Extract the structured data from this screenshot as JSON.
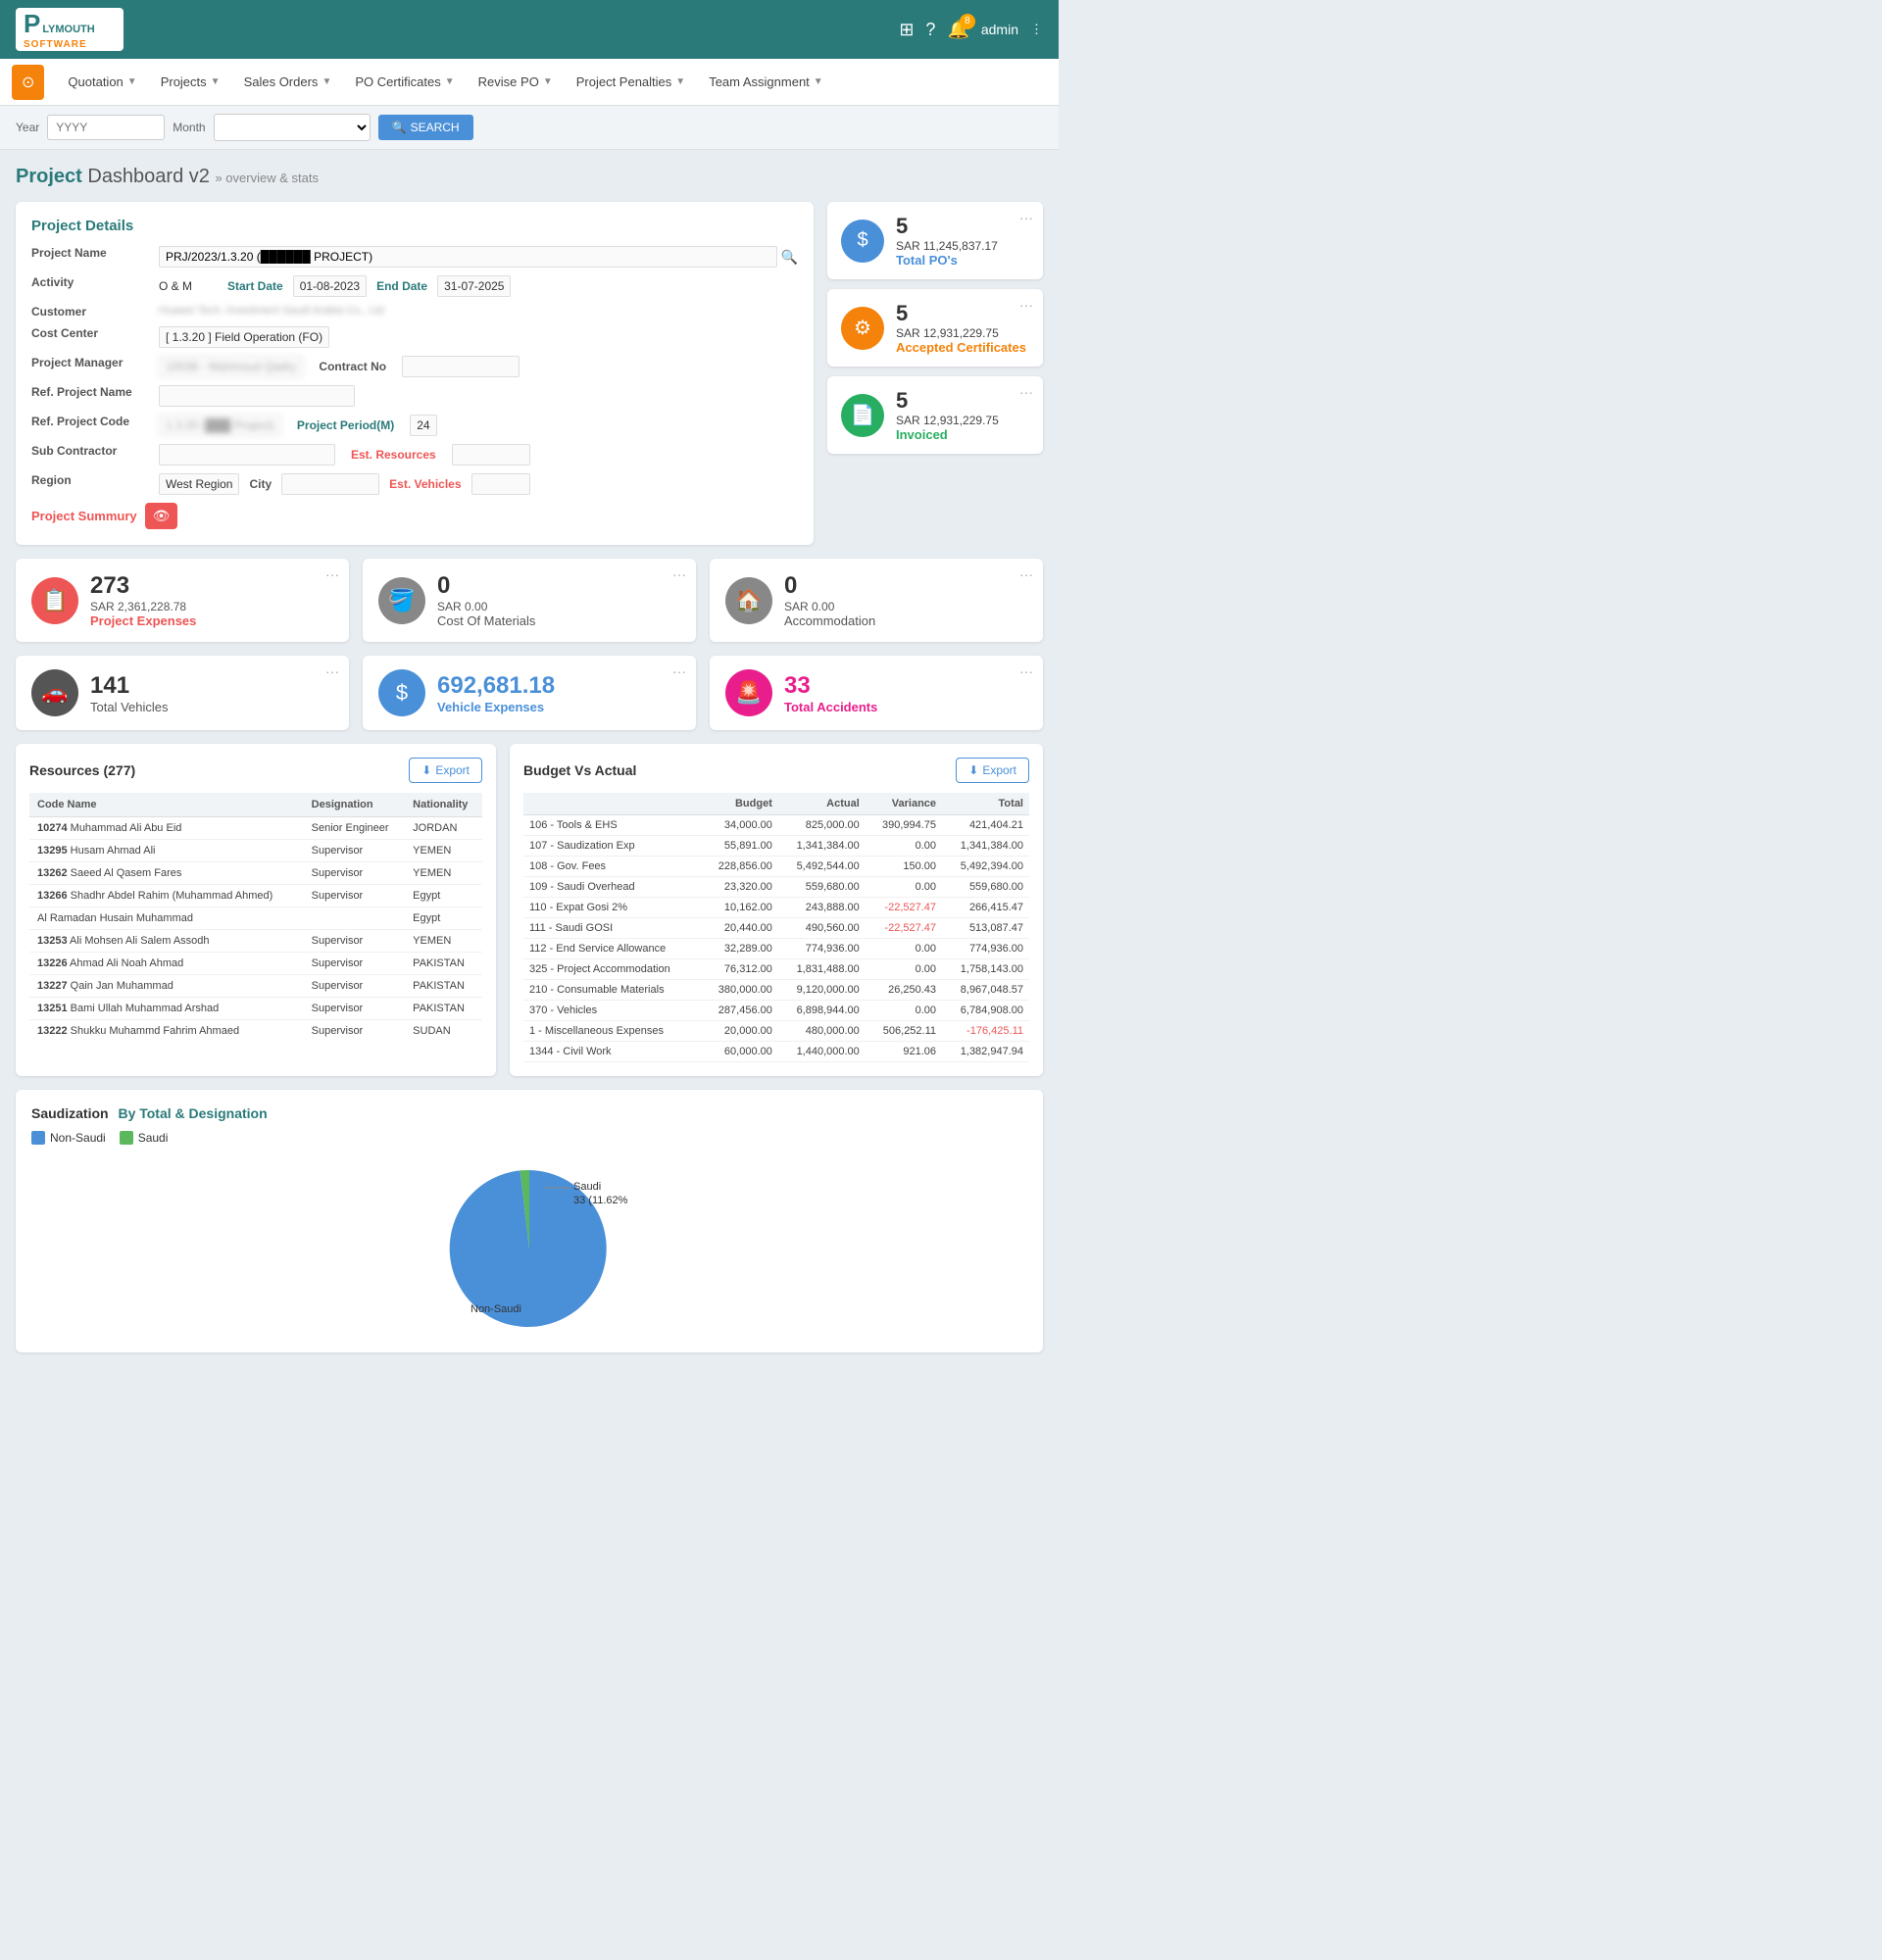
{
  "header": {
    "logo_p": "P",
    "logo_name": "LYMOUTH",
    "logo_software": "SOFTWARE",
    "notif_count": "8",
    "admin_label": "admin"
  },
  "nav": {
    "home_icon": "⊙",
    "items": [
      {
        "label": "Quotation",
        "key": "quotation"
      },
      {
        "label": "Projects",
        "key": "projects"
      },
      {
        "label": "Sales Orders",
        "key": "sales-orders"
      },
      {
        "label": "PO Certificates",
        "key": "po-certificates"
      },
      {
        "label": "Revise PO",
        "key": "revise-po"
      },
      {
        "label": "Project Penalties",
        "key": "project-penalties"
      },
      {
        "label": "Team Assignment",
        "key": "team-assignment"
      }
    ]
  },
  "filter": {
    "year_label": "Year",
    "year_placeholder": "YYYY",
    "month_label": "Month",
    "search_label": "SEARCH"
  },
  "page_title": {
    "bold": "Project",
    "rest": " Dashboard v2",
    "breadcrumb": "» overview & stats"
  },
  "project_details": {
    "title": "Project Details",
    "fields": {
      "project_name_label": "Project Name",
      "project_name_value": "PRJ/2023/1.3.20 (███████ PROJECT)",
      "activity_label": "Activity",
      "activity_value": "O & M",
      "start_date_label": "Start Date",
      "start_date_value": "01-08-2023",
      "end_date_label": "End Date",
      "end_date_value": "31-07-2025",
      "customer_label": "Customer",
      "customer_value": "Huawei Tech. Investment Saudi Arabia Co., Ltd",
      "cost_center_label": "Cost Center",
      "cost_center_value": "[ 1.3.20 ] Field Operation (FO)",
      "project_manager_label": "Project Manager",
      "project_manager_value": "10038 - Mahmoud Qadry",
      "contract_no_label": "Contract No",
      "contract_no_value": "",
      "ref_project_name_label": "Ref. Project Name",
      "ref_project_name_value": "",
      "ref_project_code_label": "Ref. Project Code",
      "ref_project_code_value": "1.3.20 (███████ Project)",
      "project_period_label": "Project Period(M)",
      "project_period_value": "24",
      "sub_contractor_label": "Sub Contractor",
      "sub_contractor_value": "",
      "est_resources_label": "Est. Resources",
      "est_resources_value": "",
      "region_label": "Region",
      "region_value": "West Region",
      "city_label": "City",
      "city_value": "",
      "est_vehicles_label": "Est. Vehicles",
      "est_vehicles_value": ""
    },
    "project_summury_label": "Project Summury"
  },
  "stat_cards": [
    {
      "count": "5",
      "amount": "SAR 11,245,837.17",
      "label": "Total PO's",
      "color": "blue",
      "icon": "$"
    },
    {
      "count": "5",
      "amount": "SAR 12,931,229.75",
      "label": "Accepted Certificates",
      "color": "orange",
      "icon": "⚙"
    },
    {
      "count": "5",
      "amount": "SAR 12,931,229.75",
      "label": "Invoiced",
      "color": "green",
      "icon": "📄"
    }
  ],
  "metric_blocks": [
    {
      "num": "273",
      "amount": "SAR 2,361,228.78",
      "label": "Project Expenses",
      "icon": "📋",
      "color": "red",
      "num_color": "default",
      "label_color": "red"
    },
    {
      "num": "0",
      "amount": "SAR 0.00",
      "label": "Cost Of Materials",
      "icon": "🪣",
      "color": "gray",
      "num_color": "default",
      "label_color": "default"
    },
    {
      "num": "0",
      "amount": "SAR 0.00",
      "label": "Accommodation",
      "icon": "🏠",
      "color": "gray",
      "num_color": "default",
      "label_color": "default"
    },
    {
      "num": "141",
      "amount": "",
      "label": "Total Vehicles",
      "icon": "🚗",
      "color": "dark",
      "num_color": "default",
      "label_color": "default"
    },
    {
      "num": "692,681.18",
      "amount": "",
      "label": "Vehicle Expenses",
      "icon": "$",
      "color": "blue",
      "num_color": "blue",
      "label_color": "blue"
    },
    {
      "num": "33",
      "amount": "",
      "label": "Total Accidents",
      "icon": "🚨",
      "color": "pink",
      "num_color": "pink",
      "label_color": "pink"
    }
  ],
  "resources": {
    "title": "Resources (277)",
    "export_label": "Export",
    "columns": [
      "Code Name",
      "Designation",
      "Nationality"
    ],
    "rows": [
      {
        "code": "10274",
        "name": "Muhammad Ali Abu Eid",
        "designation": "Senior Engineer",
        "nationality": "JORDAN"
      },
      {
        "code": "13295",
        "name": "Husam Ahmad Ali",
        "designation": "Supervisor",
        "nationality": "YEMEN"
      },
      {
        "code": "13262",
        "name": "Saeed Al Qasem Fares",
        "designation": "Supervisor",
        "nationality": "YEMEN"
      },
      {
        "code": "13266",
        "name": "Shadhr Abdel Rahim (Muhammad Ahmed)",
        "designation": "Supervisor",
        "nationality": "Egypt"
      },
      {
        "code": "",
        "name": "Al Ramadan Husain Muhammad",
        "designation": "",
        "nationality": "Egypt"
      },
      {
        "code": "13253",
        "name": "Ali Mohsen Ali Salem Assodh",
        "designation": "Supervisor",
        "nationality": "YEMEN"
      },
      {
        "code": "13226",
        "name": "Ahmad Ali Noah Ahmad",
        "designation": "Supervisor",
        "nationality": "PAKISTAN"
      },
      {
        "code": "13227",
        "name": "Qain Jan Muhammad",
        "designation": "Supervisor",
        "nationality": "PAKISTAN"
      },
      {
        "code": "13251",
        "name": "Bami Ullah Muhammad Arshad",
        "designation": "Supervisor",
        "nationality": "PAKISTAN"
      },
      {
        "code": "13222",
        "name": "Shukku Muhammd Fahrim Ahmaed",
        "designation": "Supervisor",
        "nationality": "SUDAN"
      }
    ]
  },
  "budget": {
    "title": "Budget Vs Actual",
    "export_label": "Export",
    "columns": [
      "",
      "Budget",
      "Actual",
      "Variance",
      "Total"
    ],
    "rows": [
      {
        "label": "106 - Tools & EHS",
        "budget": "34,000.00",
        "actual": "825,000.00",
        "variance": "390,994.75",
        "total": "421,404.21"
      },
      {
        "label": "107 - Saudization Exp",
        "budget": "55,891.00",
        "actual": "1,341,384.00",
        "variance": "0.00",
        "total": "1,341,384.00"
      },
      {
        "label": "108 - Gov. Fees",
        "budget": "228,856.00",
        "actual": "5,492,544.00",
        "variance": "150.00",
        "total": "5,492,394.00"
      },
      {
        "label": "109 - Saudi Overhead",
        "budget": "23,320.00",
        "actual": "559,680.00",
        "variance": "0.00",
        "total": "559,680.00"
      },
      {
        "label": "110 - Expat Gosi 2%",
        "budget": "10,162.00",
        "actual": "243,888.00",
        "variance": "-22,527.47",
        "total": "266,415.47"
      },
      {
        "label": "111 - Saudi GOSI",
        "budget": "20,440.00",
        "actual": "490,560.00",
        "variance": "-22,527.47",
        "total": "513,087.47"
      },
      {
        "label": "112 - End Service Allowance",
        "budget": "32,289.00",
        "actual": "774,936.00",
        "variance": "0.00",
        "total": "774,936.00"
      },
      {
        "label": "325 - Project Accommodation",
        "budget": "76,312.00",
        "actual": "1,831,488.00",
        "variance": "0.00",
        "total": "1,758,143.00"
      },
      {
        "label": "210 - Consumable Materials",
        "budget": "380,000.00",
        "actual": "9,120,000.00",
        "variance": "26,250.43",
        "total": "8,967,048.57"
      },
      {
        "label": "370 - Vehicles",
        "budget": "287,456.00",
        "actual": "6,898,944.00",
        "variance": "0.00",
        "total": "6,784,908.00"
      },
      {
        "label": "1 - Miscellaneous Expenses",
        "budget": "20,000.00",
        "actual": "480,000.00",
        "variance": "506,252.11",
        "total": "-176,425.11"
      },
      {
        "label": "1344 - Civil Work",
        "budget": "60,000.00",
        "actual": "1,440,000.00",
        "variance": "921.06",
        "total": "1,382,947.94"
      }
    ]
  },
  "saudization": {
    "title": "Saudization",
    "subtitle": "By Total & Designation",
    "legend": [
      {
        "label": "Non-Saudi",
        "color": "#4a90d9"
      },
      {
        "label": "Saudi",
        "color": "#5cb85c"
      }
    ],
    "pie": {
      "non_saudi_pct": 88.38,
      "saudi_pct": 11.62,
      "saudi_label": "Saudi",
      "saudi_count": "33 (11.62%)",
      "non_saudi_label": "Non-Saudi"
    }
  }
}
